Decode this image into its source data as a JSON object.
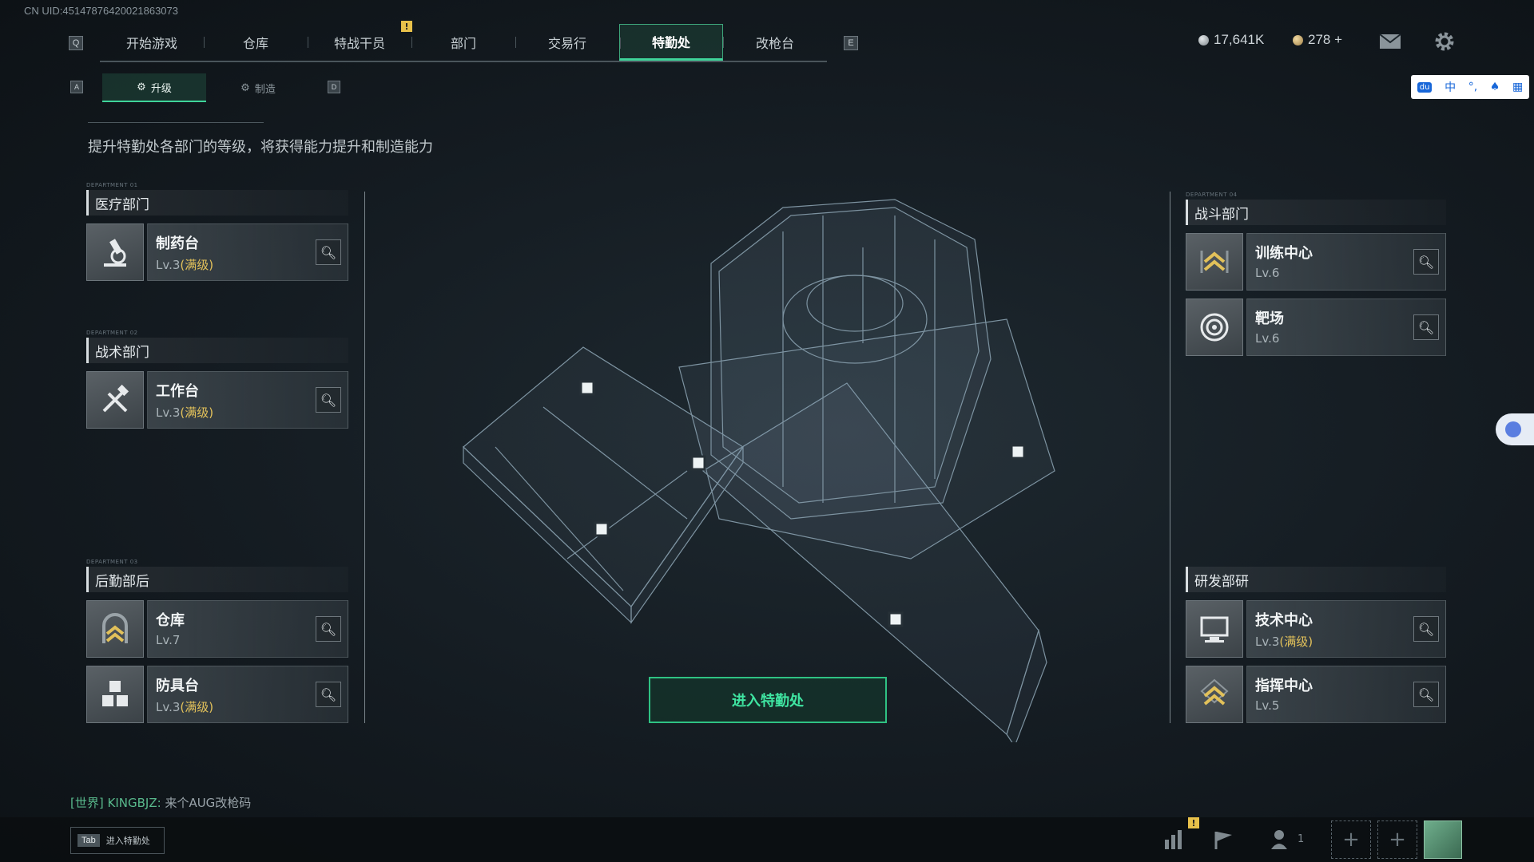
{
  "uid": "CN UID:4514787642002186307​3",
  "nav": {
    "left_key": "Q",
    "right_key": "E",
    "tabs": [
      "开始游戏",
      "仓库",
      "特战干员",
      "部门",
      "交易行",
      "特勤处",
      "改枪台"
    ],
    "active_tab": "特勤处",
    "alert": "!"
  },
  "currency": {
    "money": "17,641K",
    "coins": "278 +"
  },
  "subtabs": {
    "left_key": "A",
    "right_key": "D",
    "upgrade": "升级",
    "craft": "制造"
  },
  "description": "提升特勤处各部门的等级，将获得能力提升和制造能力",
  "departments": {
    "medical": {
      "tag": "DEPARTMENT 01",
      "title": "医疗部门",
      "items": [
        {
          "name": "制药台",
          "level": "Lv.3",
          "max": "(满级)"
        }
      ]
    },
    "tactical": {
      "tag": "DEPARTMENT 02",
      "title": "战术部门",
      "items": [
        {
          "name": "工作台",
          "level": "Lv.3",
          "max": "(满级)"
        }
      ]
    },
    "logistics": {
      "tag": "DEPARTMENT 03",
      "title": "后勤部后",
      "items": [
        {
          "name": "仓库",
          "level": "Lv.7",
          "max": ""
        },
        {
          "name": "防具台",
          "level": "Lv.3",
          "max": "(满级)"
        }
      ]
    },
    "combat": {
      "tag": "DEPARTMENT 04",
      "title": "战斗部门",
      "items": [
        {
          "name": "训练中心",
          "level": "Lv.6",
          "max": ""
        },
        {
          "name": "靶场",
          "level": "Lv.6",
          "max": ""
        }
      ]
    },
    "research": {
      "tag": "",
      "title": "研发部研",
      "items": [
        {
          "name": "技术中心",
          "level": "Lv.3",
          "max": "(满级)"
        },
        {
          "name": "指挥中心",
          "level": "Lv.5",
          "max": ""
        }
      ]
    }
  },
  "enter_button": "进入特勤处",
  "chat": {
    "channel": "[世界]",
    "user": "KINGBJZ:",
    "message": "来个AUG改枪码"
  },
  "bottom": {
    "tab_key": "Tab",
    "tab_label": "进入特勤处",
    "friends_count": "1"
  },
  "ime": {
    "lang": "中"
  },
  "colors": {
    "accent": "#3fd49a",
    "max_level": "#e2c15a",
    "alert": "#e8c14a"
  }
}
